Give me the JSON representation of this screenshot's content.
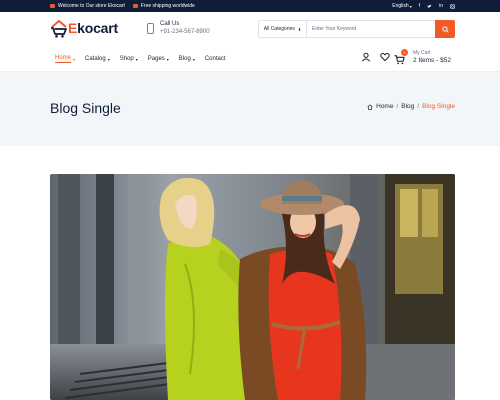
{
  "topbar": {
    "welcome": "Welcome to Our store Ekocart",
    "shipping": "Free shipping worldwide",
    "language": "English",
    "social_icons": [
      "facebook-icon",
      "twitter-icon",
      "linkedin-icon",
      "instagram-icon"
    ]
  },
  "brand": {
    "logo_e": "E",
    "logo_rest": "kocart",
    "accent": "#f05a28",
    "navy": "#0f1d3a"
  },
  "call": {
    "title": "Call Us",
    "number": "+91-234-567-8900"
  },
  "search": {
    "category": "All Categories",
    "placeholder": "Enter Your Keyword"
  },
  "menu": [
    {
      "label": "Home",
      "active": true
    },
    {
      "label": "Catalog"
    },
    {
      "label": "Shop"
    },
    {
      "label": "Pages"
    },
    {
      "label": "Blog"
    },
    {
      "label": "Contact"
    }
  ],
  "cart": {
    "badge": "0",
    "label": "My Cart",
    "summary": "2 Items - $52"
  },
  "page": {
    "title": "Blog Single"
  },
  "breadcrumb": {
    "home": "Home",
    "section": "Blog",
    "current": "Blog Single"
  }
}
